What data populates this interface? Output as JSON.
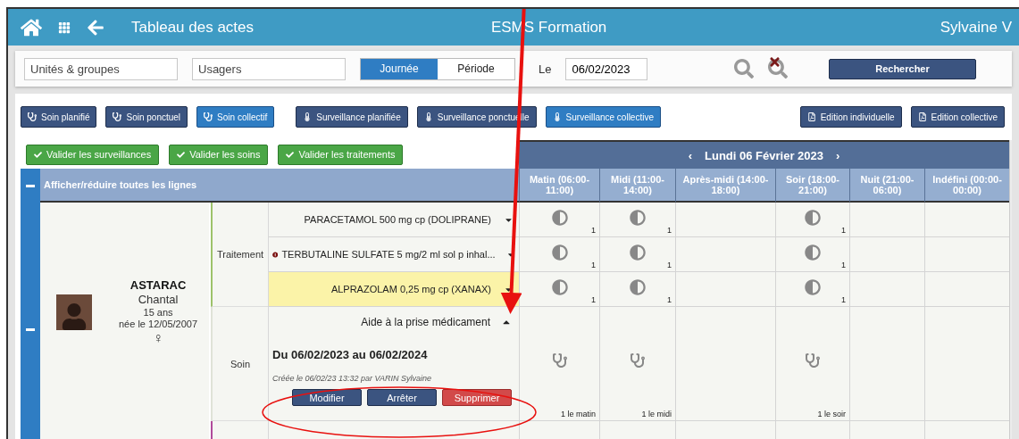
{
  "header": {
    "title": "Tableau des actes",
    "center": "ESMS Formation",
    "user": "Sylvaine V"
  },
  "filters": {
    "units": {
      "placeholder": "Unités & groupes"
    },
    "users": {
      "placeholder": "Usagers"
    },
    "modes": [
      {
        "label": "Journée",
        "selected": true
      },
      {
        "label": "Période",
        "selected": false
      }
    ],
    "date_label": "Le",
    "date_value": "06/02/2023",
    "search_button": "Rechercher"
  },
  "actions": [
    {
      "label": "Soin planifié",
      "kind": "soin",
      "selected": false
    },
    {
      "label": "Soin ponctuel",
      "kind": "soin",
      "selected": false
    },
    {
      "label": "Soin collectif",
      "kind": "soin",
      "selected": true
    },
    {
      "label": "Surveillance planifiée",
      "kind": "surveillance",
      "selected": false
    },
    {
      "label": "Surveillance ponctuelle",
      "kind": "surveillance",
      "selected": false
    },
    {
      "label": "Surveillance collective",
      "kind": "surveillance",
      "selected": true
    },
    {
      "label": "Edition individuelle",
      "kind": "edition",
      "selected": false
    },
    {
      "label": "Edition collective",
      "kind": "edition",
      "selected": false
    }
  ],
  "validate_buttons": [
    "Valider les surveillances",
    "Valider les soins",
    "Valider les traitements"
  ],
  "table": {
    "prev": "‹",
    "date": "Lundi 06 Février 2023",
    "next": "›",
    "toggle_all": "Afficher/réduire toutes les lignes",
    "columns": [
      "Matin (06:00-11:00)",
      "Midi (11:00-14:00)",
      "Après-midi (14:00-18:00)",
      "Soir (18:00-21:00)",
      "Nuit (21:00-06:00)",
      "Indéfini (00:00-00:00)"
    ],
    "patient": {
      "last_name": "ASTARAC",
      "first_name": "Chantal",
      "age": "15 ans",
      "birth": "née le 12/05/2007",
      "sex": "♀"
    },
    "groups": [
      {
        "category": "Traitement",
        "color": "#9dc26b",
        "items": [
          {
            "kind": "treatment",
            "name": "PARACETAMOL 500 mg cp (DOLIPRANE)",
            "alert": false,
            "highlighted": false,
            "expanded": false,
            "slots": [
              {
                "filled": true,
                "text": "1"
              },
              {
                "filled": true,
                "text": "1"
              },
              {
                "filled": false
              },
              {
                "filled": true,
                "text": "1"
              },
              {
                "filled": false
              },
              {
                "filled": false
              }
            ]
          },
          {
            "kind": "treatment",
            "name": "TERBUTALINE SULFATE 5 mg/2 ml sol p inhal...",
            "alert": true,
            "highlighted": false,
            "expanded": false,
            "slots": [
              {
                "filled": true,
                "text": "1"
              },
              {
                "filled": true,
                "text": "1"
              },
              {
                "filled": false
              },
              {
                "filled": true,
                "text": "1"
              },
              {
                "filled": false
              },
              {
                "filled": false
              }
            ]
          },
          {
            "kind": "treatment",
            "name": "ALPRAZOLAM 0,25 mg cp (XANAX)",
            "alert": false,
            "highlighted": true,
            "expanded": false,
            "slots": [
              {
                "filled": true,
                "text": "1"
              },
              {
                "filled": true,
                "text": "1"
              },
              {
                "filled": false
              },
              {
                "filled": true,
                "text": "1"
              },
              {
                "filled": false
              },
              {
                "filled": false
              }
            ]
          }
        ]
      },
      {
        "category": "Soin",
        "color": "#dfe3d8",
        "items": [
          {
            "kind": "care",
            "name": "Aide à la prise médicament",
            "alert": false,
            "highlighted": false,
            "expanded": true,
            "period": "Du 06/02/2023 au 06/02/2024",
            "created": "Créée le 06/02/23 13:32 par VARIN Sylvaine",
            "buttons": [
              {
                "label": "Modifier",
                "kind": "primary"
              },
              {
                "label": "Arrêter",
                "kind": "primary"
              },
              {
                "label": "Supprimer",
                "kind": "danger"
              }
            ],
            "slots": [
              {
                "filled": true,
                "text": "1 le matin"
              },
              {
                "filled": true,
                "text": "1 le midi"
              },
              {
                "filled": false
              },
              {
                "filled": true,
                "text": "1 le soir"
              },
              {
                "filled": false
              },
              {
                "filled": false
              }
            ]
          }
        ]
      }
    ]
  }
}
